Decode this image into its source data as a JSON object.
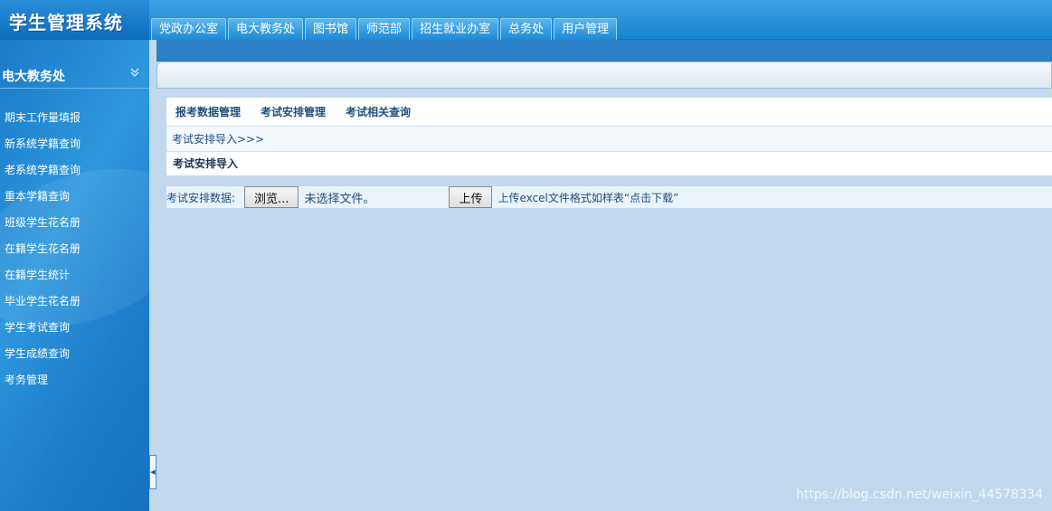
{
  "app": {
    "title": "学生管理系统"
  },
  "topnav": [
    {
      "label": "党政办公室"
    },
    {
      "label": "电大教务处"
    },
    {
      "label": "图书馆"
    },
    {
      "label": "师范部"
    },
    {
      "label": "招生就业办室"
    },
    {
      "label": "总务处"
    },
    {
      "label": "用户管理"
    }
  ],
  "sidebar": {
    "title": "电大教务处",
    "collapse_icon": "chevron-double-down",
    "items": [
      {
        "label": "期末工作量填报"
      },
      {
        "label": "新系统学籍查询"
      },
      {
        "label": "老系统学籍查询"
      },
      {
        "label": "重本学籍查询"
      },
      {
        "label": "班级学生花名册"
      },
      {
        "label": "在籍学生花名册"
      },
      {
        "label": "在籍学生统计"
      },
      {
        "label": "毕业学生花名册"
      },
      {
        "label": "学生考试查询"
      },
      {
        "label": "学生成绩查询"
      },
      {
        "label": "考务管理"
      }
    ]
  },
  "main": {
    "subtabs": [
      {
        "label": "报考数据管理"
      },
      {
        "label": "考试安排管理"
      },
      {
        "label": "考试相关查询"
      }
    ],
    "breadcrumb": "考试安排导入>>>",
    "section_title": "考试安排导入",
    "form": {
      "label": "考试安排数据:",
      "browse_label": "浏览...",
      "file_status": "未选择文件。",
      "upload_label": "上传",
      "hint": "上传excel文件格式如样表“点击下载”"
    }
  },
  "watermark": "https://blog.csdn.net/weixin_44578334"
}
